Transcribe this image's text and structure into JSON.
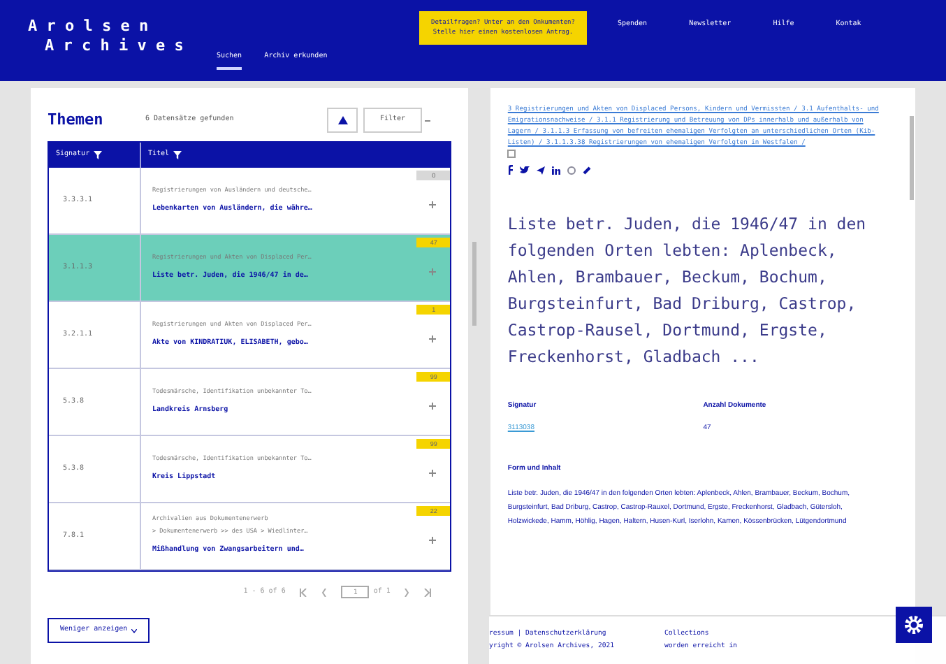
{
  "header": {
    "logo_line_1": "A r o l s e n",
    "logo_line_2": "A r c h i v e s",
    "banner": [
      "Detailfragen? Unter an den Onkumenten?",
      "Stelle hier einen kostenlosen Antrag."
    ],
    "nav": [
      "Spenden",
      "Newsletter",
      "Hilfe",
      "Kontak"
    ],
    "tabs": [
      {
        "label": "Suchen",
        "selected": true
      },
      {
        "label": "Archiv erkunden",
        "selected": false
      }
    ]
  },
  "list": {
    "title": "Themen",
    "count": "6 Datensätze gefunden",
    "filter_button": "Filter",
    "columns": [
      "Signatur",
      "Titel"
    ],
    "rows": [
      {
        "signature": "3.3.3.1",
        "context": [
          "Registrierungen von Ausländern und deutsche…"
        ],
        "title": "Lebenkarten von Ausländern, die währe…",
        "badge": "0",
        "color": "#d8d8d8",
        "selected": false
      },
      {
        "signature": "3.1.1.3",
        "context": [
          "Registrierungen und Akten von Displaced Per…"
        ],
        "title": "Liste betr. Juden, die 1946/47 in de…",
        "badge": "47",
        "color": "#f5d400",
        "selected": true
      },
      {
        "signature": "3.2.1.1",
        "context": [
          "Registrierungen und Akten von Displaced Per…"
        ],
        "title": "Akte von KINDRATIUK, ELISABETH, gebo…",
        "badge": "1",
        "color": "#f5d400",
        "selected": false
      },
      {
        "signature": "5.3.8",
        "context": [
          "Todesmärsche, Identifikation unbekannter To…"
        ],
        "title": "Landkreis Arnsberg",
        "badge": "99",
        "color": "#f5d400",
        "selected": false
      },
      {
        "signature": "5.3.8",
        "context": [
          "Todesmärsche, Identifikation unbekannter To…"
        ],
        "title": "Kreis Lippstadt",
        "badge": "99",
        "color": "#f5d400",
        "selected": false
      },
      {
        "signature": "7.8.1",
        "context": [
          "Archivalien aus Dokumentenerwerb",
          "> Dokumentenerwerb >> des USA > Wiedlinter…"
        ],
        "title": "Mißhandlung von Zwangsarbeitern und…",
        "badge": "22",
        "color": "#f5d400",
        "selected": false
      }
    ],
    "pagination": {
      "range": "1 - 6 of 6",
      "page": "1",
      "of": "of 1"
    },
    "less_button": "Weniger anzeigen"
  },
  "detail": {
    "breadcrumbs": "3 Registrierungen und Akten von Displaced Persons, Kindern und Vermissten / 3.1 Aufenthalts- und Emigrationsnachweise / 3.1.1 Registrierung und Betreuung von DPs innerhalb und außerhalb von Lagern / 3.1.1.3 Erfassung von befreiten ehemaligen Verfolgten an unterschiedlichen Orten (Kib-Listen) / 3.1.1.3.38 Registrierungen von ehemaligen Verfolgten in Westfalen /",
    "title": "Liste betr. Juden, die 1946/47 in den folgenden Orten lebten: Aplenbeck, Ahlen, Brambauer, Beckum, Bochum, Burgsteinfurt, Bad Driburg, Castrop, Castrop-Rausel, Dortmund, Ergste, Freckenhorst, Gladbach ...",
    "fields": [
      {
        "label": "Signatur",
        "value": "3113038",
        "kind": "link"
      },
      {
        "label": "Anzahl Dokumente",
        "value": "47",
        "kind": "text"
      }
    ],
    "content_heading": "Form und Inhalt",
    "content": "Liste betr. Juden, die 1946/47 in den folgenden Orten lebten: Aplenbeck, Ahlen, Brambauer, Beckum, Bochum, Burgsteinfurt, Bad Driburg, Castrop, Castrop-Rauxel, Dortmund, Ergste, Freckenhorst, Gladbach, Gütersloh, Holzwickede, Hamm, Höhlig, Hagen, Haltern, Husen-Kurl, Iserlohn, Kamen, Kössenbrücken, Lütgendortmund"
  },
  "footer": {
    "links": "ressum  |  Datenschutzerklärung",
    "copyright": "yright © Arolsen Archives, 2021",
    "col2": [
      "Collections",
      "worden erreicht in"
    ]
  }
}
